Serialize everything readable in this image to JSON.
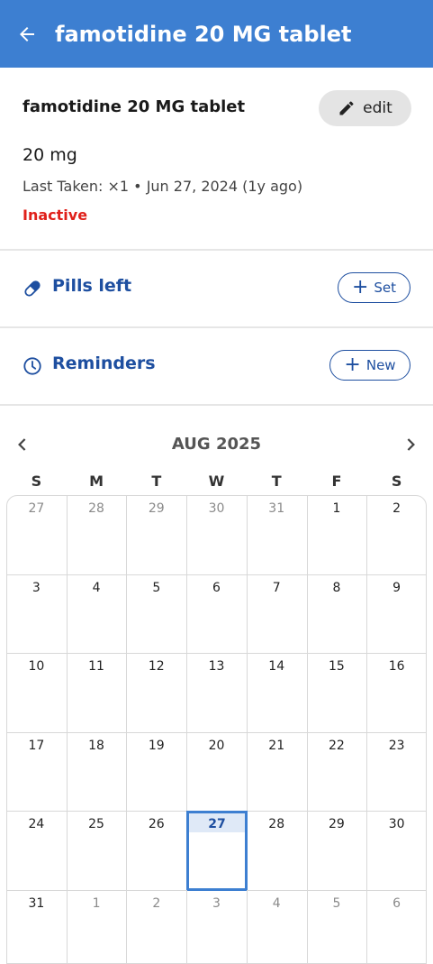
{
  "appbar": {
    "title": "famotidine 20 MG tablet",
    "back_icon": "arrow-left-icon",
    "color": "#3d7fd1"
  },
  "medication": {
    "name": "famotidine 20 MG tablet",
    "edit_label": "edit",
    "dose": "20 mg",
    "last_taken": "Last Taken: ×1 • Jun 27, 2024 (1y ago)",
    "status": "Inactive",
    "status_color": "#e0201a"
  },
  "pills_left": {
    "label": "Pills left",
    "icon": "pill-icon",
    "button_label": "Set"
  },
  "reminders": {
    "label": "Reminders",
    "icon": "clock-icon",
    "button_label": "New"
  },
  "calendar": {
    "month_label": "AUG 2025",
    "weekdays": [
      "S",
      "M",
      "T",
      "W",
      "T",
      "F",
      "S"
    ],
    "today": "27",
    "weeks": [
      [
        {
          "d": "27",
          "m": true
        },
        {
          "d": "28",
          "m": true
        },
        {
          "d": "29",
          "m": true
        },
        {
          "d": "30",
          "m": true
        },
        {
          "d": "31",
          "m": true
        },
        {
          "d": "1",
          "m": false
        },
        {
          "d": "2",
          "m": false
        }
      ],
      [
        {
          "d": "3",
          "m": false
        },
        {
          "d": "4",
          "m": false
        },
        {
          "d": "5",
          "m": false
        },
        {
          "d": "6",
          "m": false
        },
        {
          "d": "7",
          "m": false
        },
        {
          "d": "8",
          "m": false
        },
        {
          "d": "9",
          "m": false
        }
      ],
      [
        {
          "d": "10",
          "m": false
        },
        {
          "d": "11",
          "m": false
        },
        {
          "d": "12",
          "m": false
        },
        {
          "d": "13",
          "m": false
        },
        {
          "d": "14",
          "m": false
        },
        {
          "d": "15",
          "m": false
        },
        {
          "d": "16",
          "m": false
        }
      ],
      [
        {
          "d": "17",
          "m": false
        },
        {
          "d": "18",
          "m": false
        },
        {
          "d": "19",
          "m": false
        },
        {
          "d": "20",
          "m": false
        },
        {
          "d": "21",
          "m": false
        },
        {
          "d": "22",
          "m": false
        },
        {
          "d": "23",
          "m": false
        }
      ],
      [
        {
          "d": "24",
          "m": false
        },
        {
          "d": "25",
          "m": false
        },
        {
          "d": "26",
          "m": false
        },
        {
          "d": "27",
          "m": false,
          "today": true
        },
        {
          "d": "28",
          "m": false
        },
        {
          "d": "29",
          "m": false
        },
        {
          "d": "30",
          "m": false
        }
      ],
      [
        {
          "d": "31",
          "m": false
        },
        {
          "d": "1",
          "m": true
        },
        {
          "d": "2",
          "m": true
        },
        {
          "d": "3",
          "m": true
        },
        {
          "d": "4",
          "m": true
        },
        {
          "d": "5",
          "m": true
        },
        {
          "d": "6",
          "m": true
        }
      ]
    ]
  }
}
